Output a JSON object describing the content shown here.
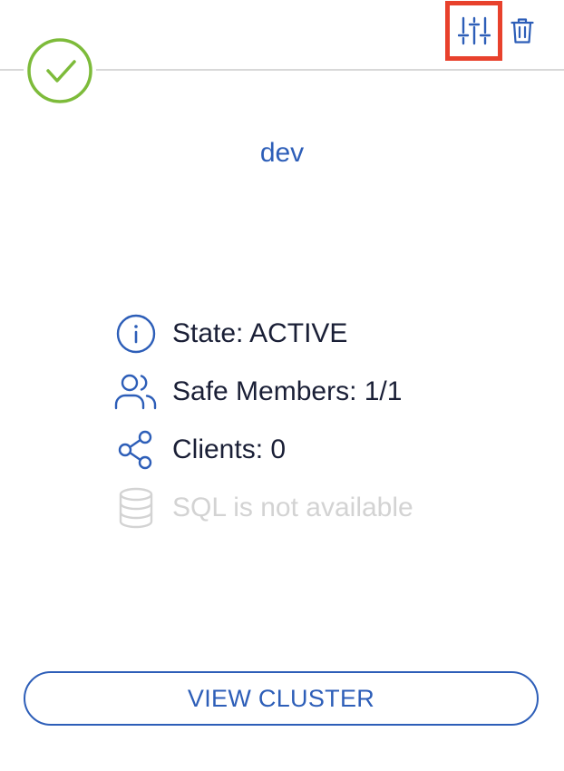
{
  "card": {
    "cluster_name": "dev",
    "status": "active",
    "stats": {
      "state": "State: ACTIVE",
      "safe_members": "Safe Members: 1/1",
      "clients": "Clients: 0",
      "sql": "SQL is not available"
    },
    "view_button_label": "VIEW CLUSTER"
  },
  "icons": {
    "status": "check-circle-icon",
    "settings": "sliders-icon",
    "delete": "trash-icon",
    "state": "info-icon",
    "members": "users-icon",
    "clients": "share-icon",
    "sql": "database-icon"
  },
  "colors": {
    "accent": "#2d5eb8",
    "success": "#7dbb3a",
    "highlight": "#e8412c",
    "disabled": "#d3d3d3",
    "text": "#1a1f36"
  }
}
